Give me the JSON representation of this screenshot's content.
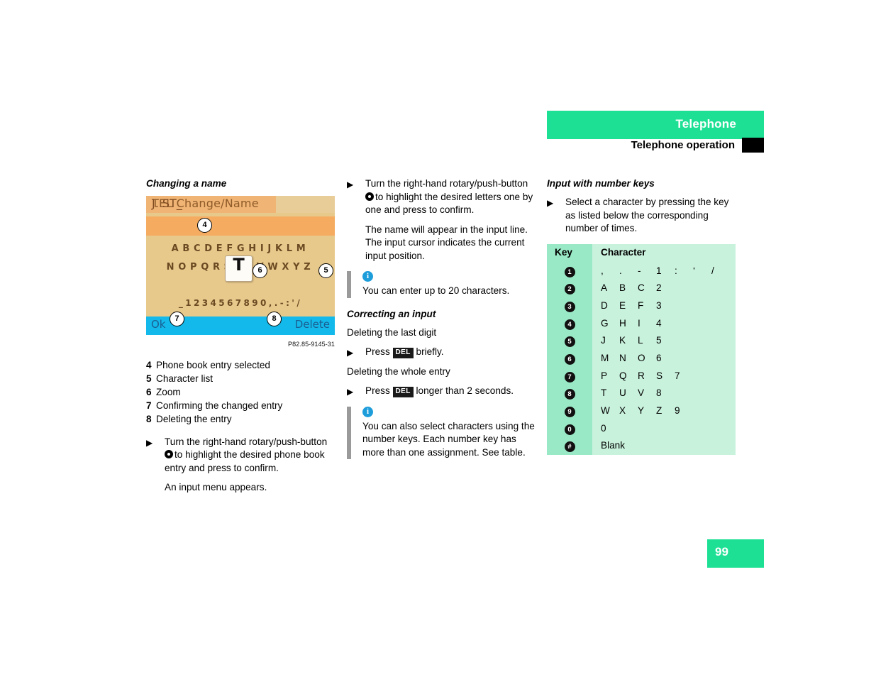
{
  "header": {
    "chapter": "Telephone",
    "section": "Telephone operation",
    "green": "#1ee095"
  },
  "page_number": "99",
  "col1": {
    "heading": "Changing a name",
    "device_screen": {
      "title": "TEL Change/Name",
      "input_value": "J. ST_",
      "row1": "ABCDEFGHIJKLM",
      "row2": "NOPQRSTUVWXYZ",
      "zoom_char": "T",
      "digits": "_1234567890,.-:'/",
      "ok_label": "Ok",
      "delete_label": "Delete",
      "callouts": [
        "4",
        "5",
        "6",
        "7",
        "8"
      ]
    },
    "caption": "P82.85-9145-31",
    "legend": [
      {
        "num": "4",
        "text": "Phone book entry selected"
      },
      {
        "num": "5",
        "text": "Character list"
      },
      {
        "num": "6",
        "text": "Zoom"
      },
      {
        "num": "7",
        "text": "Confirming the changed entry"
      },
      {
        "num": "8",
        "text": "Deleting the entry"
      }
    ],
    "step": {
      "part1": "Turn the right-hand rotary/push-button",
      "part2": "to highlight the desired phone book entry and press to confirm."
    },
    "result": "An input menu appears."
  },
  "col2": {
    "step": {
      "part1": "Turn the right-hand rotary/push-button",
      "part2": "to highlight the desired letters one by one and press to confirm."
    },
    "result": "The name will appear in the input line. The input cursor indicates the current input position.",
    "note1": {
      "icon": "info-icon",
      "text": "You can enter up to 20 characters."
    },
    "heading": "Correcting an input",
    "sub1": "Deleting the last digit",
    "step1_pre": "Press",
    "step1_key": "DEL",
    "step1_post": "briefly.",
    "sub2": "Deleting the whole entry",
    "step2_pre": "Press",
    "step2_key": "DEL",
    "step2_post": "longer than 2 seconds.",
    "note2": {
      "icon": "info-icon",
      "text": "You can also select characters using the number keys. Each number key has more than one assignment. See table."
    }
  },
  "col3": {
    "heading": "Input with number keys",
    "step": "Select a character by pressing the key as listed below the corresponding number of times.",
    "table": {
      "head_key": "Key",
      "head_char": "Character",
      "rows": [
        {
          "key": "1",
          "chars": [
            ",",
            ".",
            "-",
            "1",
            ":",
            "‘",
            "/"
          ]
        },
        {
          "key": "2",
          "chars": [
            "A",
            "B",
            "C",
            "2"
          ]
        },
        {
          "key": "3",
          "chars": [
            "D",
            "E",
            "F",
            "3"
          ]
        },
        {
          "key": "4",
          "chars": [
            "G",
            "H",
            "I",
            "4"
          ]
        },
        {
          "key": "5",
          "chars": [
            "J",
            "K",
            "L",
            "5"
          ]
        },
        {
          "key": "6",
          "chars": [
            "M",
            "N",
            "O",
            "6"
          ]
        },
        {
          "key": "7",
          "chars": [
            "P",
            "Q",
            "R",
            "S",
            "7"
          ]
        },
        {
          "key": "8",
          "chars": [
            "T",
            "U",
            "V",
            "8"
          ]
        },
        {
          "key": "9",
          "chars": [
            "W",
            "X",
            "Y",
            "Z",
            "9"
          ]
        },
        {
          "key": "0",
          "chars": [
            "0"
          ]
        },
        {
          "key": "#",
          "chars": [
            "Blank"
          ]
        }
      ]
    }
  }
}
